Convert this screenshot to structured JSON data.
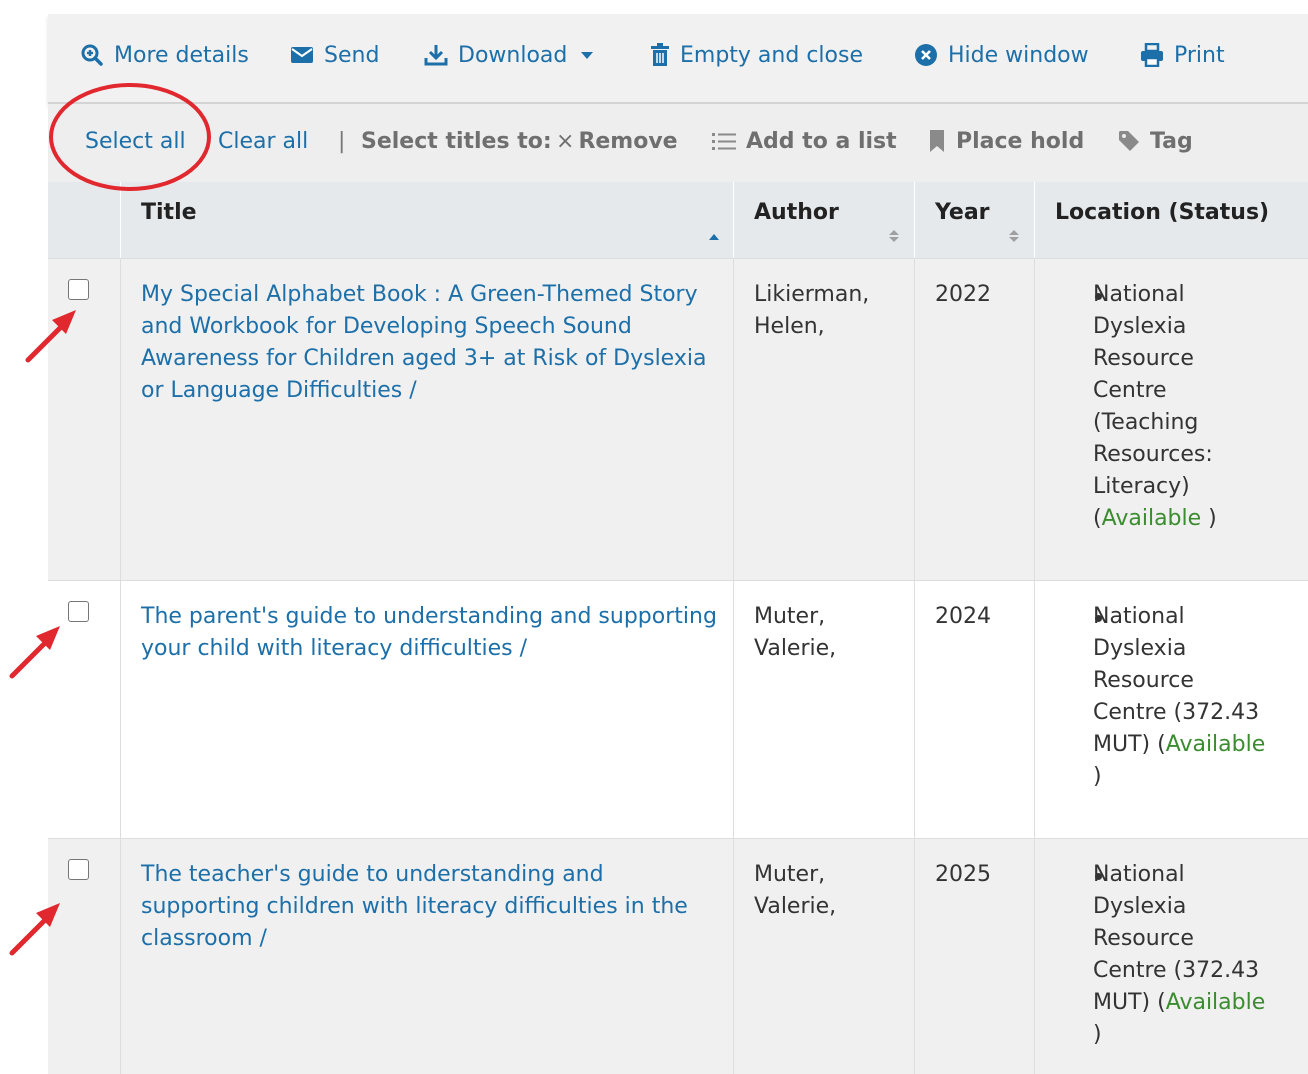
{
  "toolbar": {
    "more_details": "More details",
    "send": "Send",
    "download": "Download",
    "empty_close": "Empty and close",
    "hide_window": "Hide window",
    "print": "Print"
  },
  "selection": {
    "select_all": "Select all",
    "clear_all": "Clear all",
    "separator": "|",
    "select_titles_to": "Select titles to:",
    "remove": "Remove",
    "add_to_list": "Add to a list",
    "place_hold": "Place hold",
    "tag": "Tag"
  },
  "table": {
    "headers": {
      "title": "Title",
      "author": "Author",
      "year": "Year",
      "location": "Location (Status)"
    },
    "rows": [
      {
        "title": "My Special Alphabet Book : A Green-Themed Story and Workbook for Developing Speech Sound Awareness for Children aged 3+ at Risk of Dyslexia or Language Difficulties /",
        "author": "Likierman, Helen,",
        "year": "2022",
        "location": "National Dyslexia Resource Centre (Teaching Resources: Literacy) (",
        "status": "Available",
        "close": " )"
      },
      {
        "title": "The parent's guide to understanding and supporting your child with literacy difficulties /",
        "author": "Muter, Valerie,",
        "year": "2024",
        "location": "National Dyslexia Resource Centre (372.43 MUT) (",
        "status": "Available",
        "close": " )"
      },
      {
        "title": "The teacher's guide to understanding and supporting children with literacy difficulties in the classroom /",
        "author": "Muter, Valerie,",
        "year": "2025",
        "location": "National Dyslexia Resource Centre (372.43 MUT) (",
        "status": "Available",
        "close": " )"
      }
    ]
  },
  "colors": {
    "link": "#1c6fa8",
    "available": "#3a8c2f",
    "annotation": "#e0282e"
  }
}
